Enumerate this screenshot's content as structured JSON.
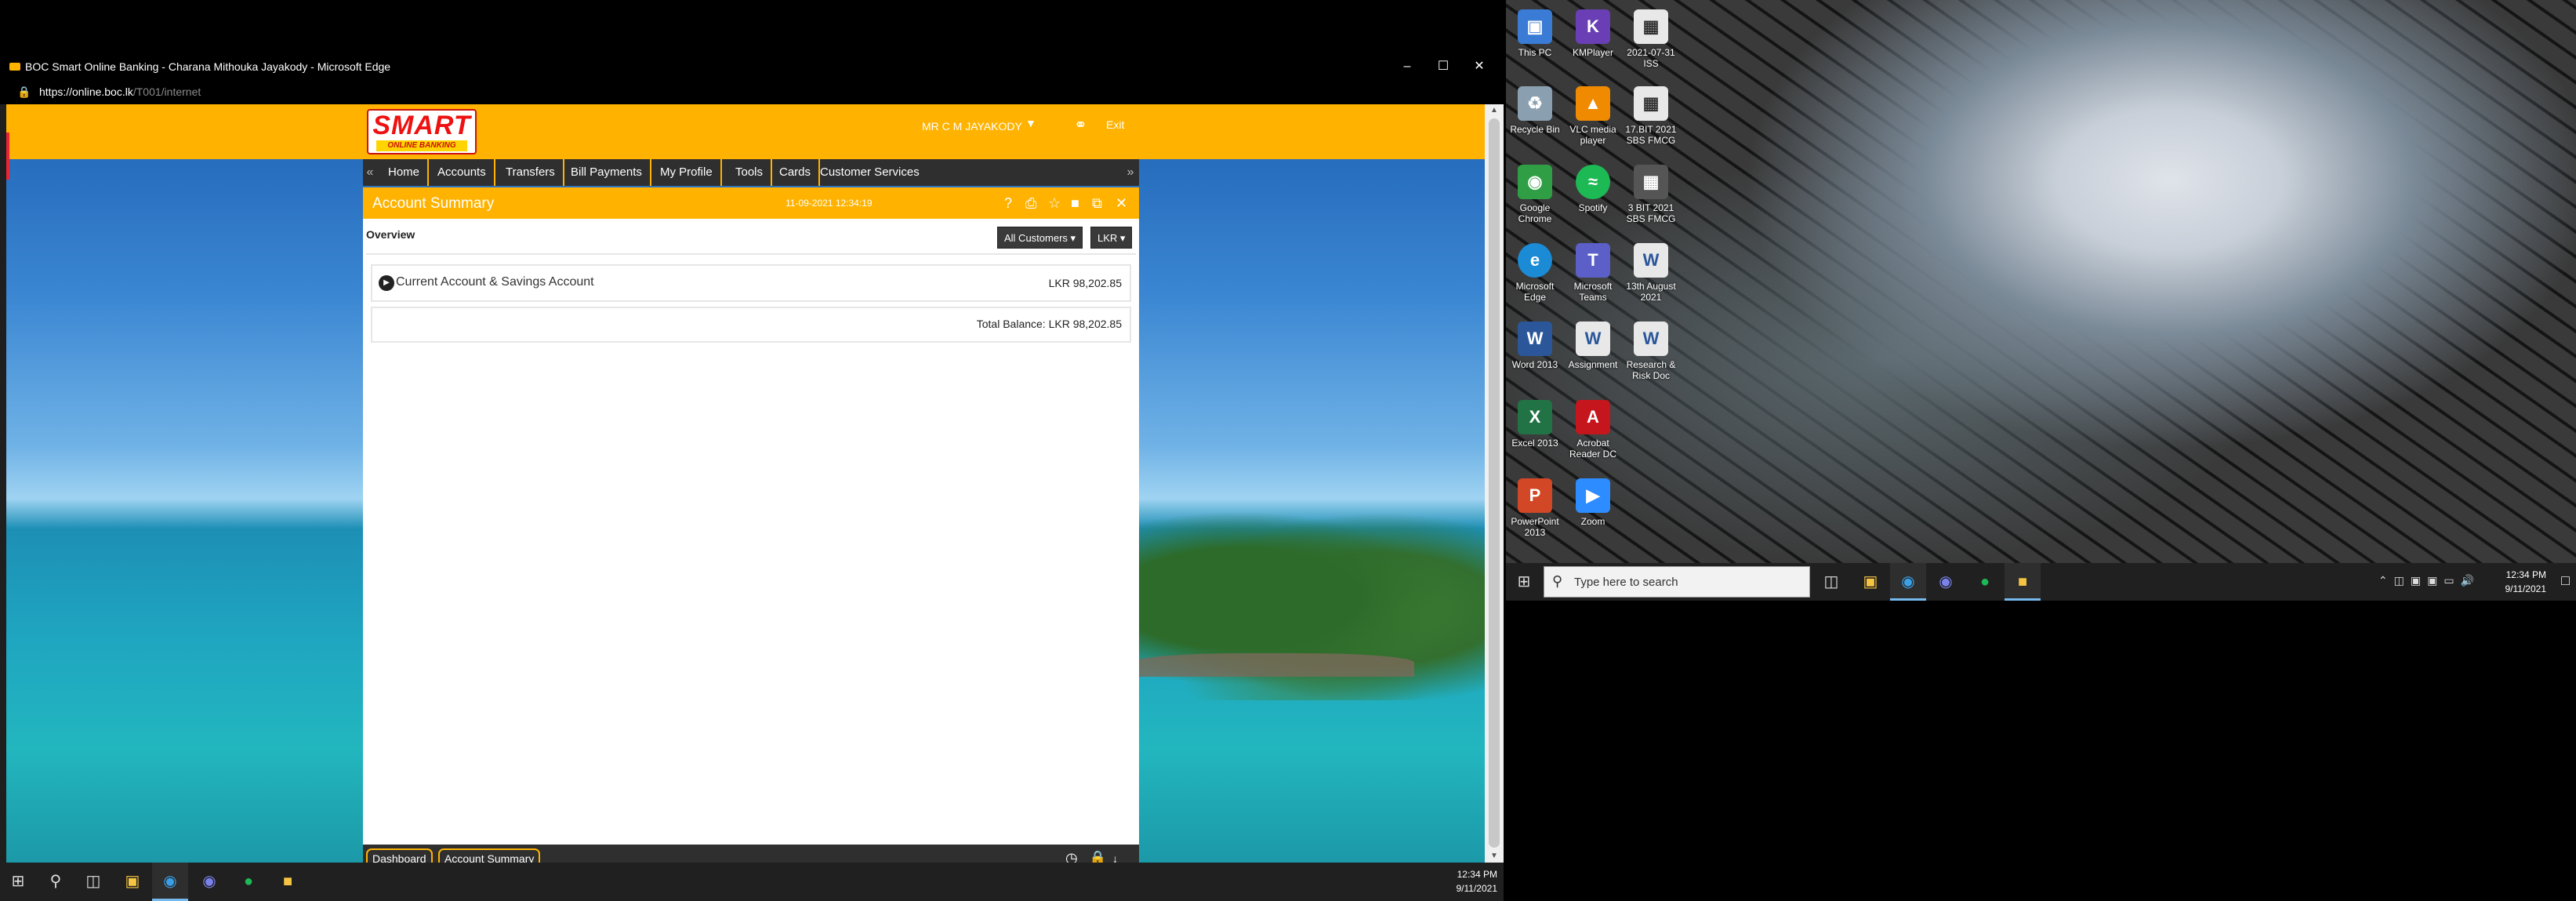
{
  "edge": {
    "window_title": "BOC Smart Online Banking - Charana Mithouka Jayakody - Microsoft Edge",
    "url_host": "https://online.boc.lk",
    "url_path": "/T001/internet",
    "controls": [
      "minimize",
      "maximize",
      "close"
    ]
  },
  "site": {
    "logo_text": "SMART",
    "logo_subtext": "ONLINE BANKING",
    "user_name": "MR C M JAYAKODY",
    "exit_label": "Exit",
    "nav": [
      "Home",
      "Accounts",
      "Transfers",
      "Bill Payments",
      "My Profile",
      "Tools",
      "Cards",
      "Customer Services"
    ],
    "panel": {
      "title": "Account Summary",
      "datetime": "11-09-2021 12:34:19",
      "overview_label": "Overview",
      "customer_select": "All Customers",
      "currency_select": "LKR",
      "account_type": "Current Account & Savings Account",
      "account_balance": "LKR 98,202.85",
      "total_balance": "Total Balance: LKR 98,202.85"
    },
    "bottom_tabs": [
      "Dashboard",
      "Account Summary"
    ]
  },
  "left_taskbar": {
    "time": "12:34 PM",
    "date": "9/11/2021"
  },
  "desktop": {
    "icons": [
      {
        "label": "This PC",
        "color": "#3a7bd5"
      },
      {
        "label": "KMPlayer",
        "color": "#6a3fb5"
      },
      {
        "label": "2021-07-31 ISS",
        "color": "#e8e8e8"
      },
      {
        "label": "Recycle Bin",
        "color": "#8aa0b0"
      },
      {
        "label": "VLC media player",
        "color": "#f08a00"
      },
      {
        "label": "17.BIT 2021 SBS FMCG",
        "color": "#e8e8e8"
      },
      {
        "label": "Google Chrome",
        "color": "#2f9e44"
      },
      {
        "label": "Spotify",
        "color": "#1db954"
      },
      {
        "label": "3 BIT 2021 SBS FMCG",
        "color": "#555555"
      },
      {
        "label": "Microsoft Edge",
        "color": "#1b8bd6"
      },
      {
        "label": "Microsoft Teams",
        "color": "#5b5fc7"
      },
      {
        "label": "13th August 2021",
        "color": "#e8e8e8"
      },
      {
        "label": "Word 2013",
        "color": "#2b579a"
      },
      {
        "label": "Assignment",
        "color": "#2b579a"
      },
      {
        "label": "Research & Risk Doc",
        "color": "#2b579a"
      },
      {
        "label": "Excel 2013",
        "color": "#217346"
      },
      {
        "label": "Acrobat Reader DC",
        "color": "#c4161c"
      },
      {
        "label": "PowerPoint 2013",
        "color": "#d24726"
      },
      {
        "label": "Zoom",
        "color": "#2d8cff"
      }
    ],
    "search_placeholder": "Type here to search",
    "time": "12:34 PM",
    "date": "9/11/2021"
  }
}
